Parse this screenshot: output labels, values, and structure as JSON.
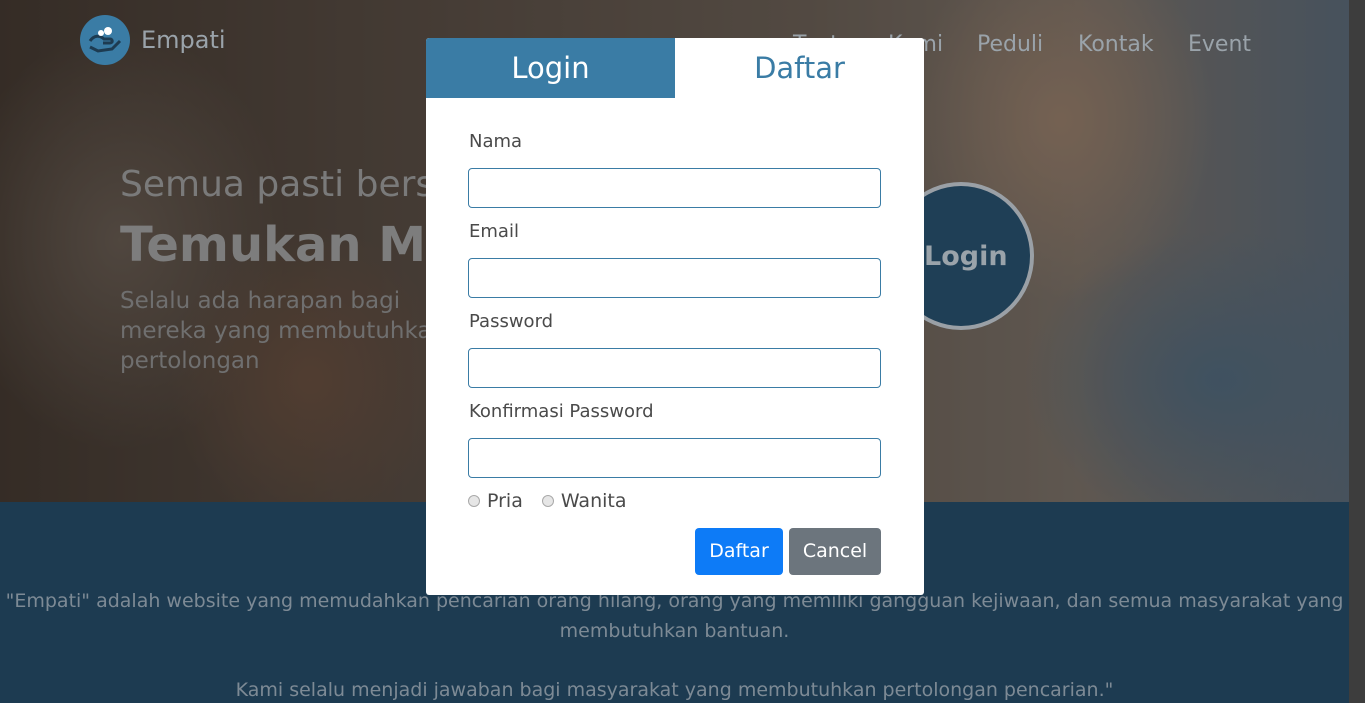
{
  "brand": {
    "name": "Empati",
    "logo_icon": "hands-heart-icon"
  },
  "nav": {
    "items": [
      {
        "label": "Tentang"
      },
      {
        "label": "Kami"
      },
      {
        "label": "Peduli"
      },
      {
        "label": "Kontak"
      },
      {
        "label": "Event"
      }
    ]
  },
  "hero": {
    "subtitle": "Semua pasti bersama",
    "title": "Temukan Mereka",
    "description": "Selalu ada harapan bagi mereka yang membutuhkan pertolongan",
    "circle_button": "Login"
  },
  "about": {
    "paragraph_1": "\"Empati\" adalah website yang memudahkan pencarian orang hilang, orang yang memiliki gangguan kejiwaan, dan semua masyarakat yang membutuhkan bantuan.",
    "paragraph_2": "Kami selalu menjadi jawaban bagi masyarakat yang membutuhkan pertolongan pencarian.\""
  },
  "modal": {
    "tabs": {
      "login": "Login",
      "daftar": "Daftar"
    },
    "fields": {
      "nama": {
        "label": "Nama",
        "value": "",
        "placeholder": ""
      },
      "email": {
        "label": "Email",
        "value": "",
        "placeholder": ""
      },
      "password": {
        "label": "Password",
        "value": "",
        "placeholder": ""
      },
      "konfirmasi": {
        "label": "Konfirmasi Password",
        "value": "",
        "placeholder": ""
      }
    },
    "gender": {
      "option_1": "Pria",
      "option_2": "Wanita"
    },
    "buttons": {
      "submit": "Daftar",
      "cancel": "Cancel"
    }
  },
  "colors": {
    "primary": "#3a7ca5",
    "dark_section": "#1d3b51",
    "submit_button": "#0d7bf7",
    "cancel_button": "#6c757d"
  }
}
